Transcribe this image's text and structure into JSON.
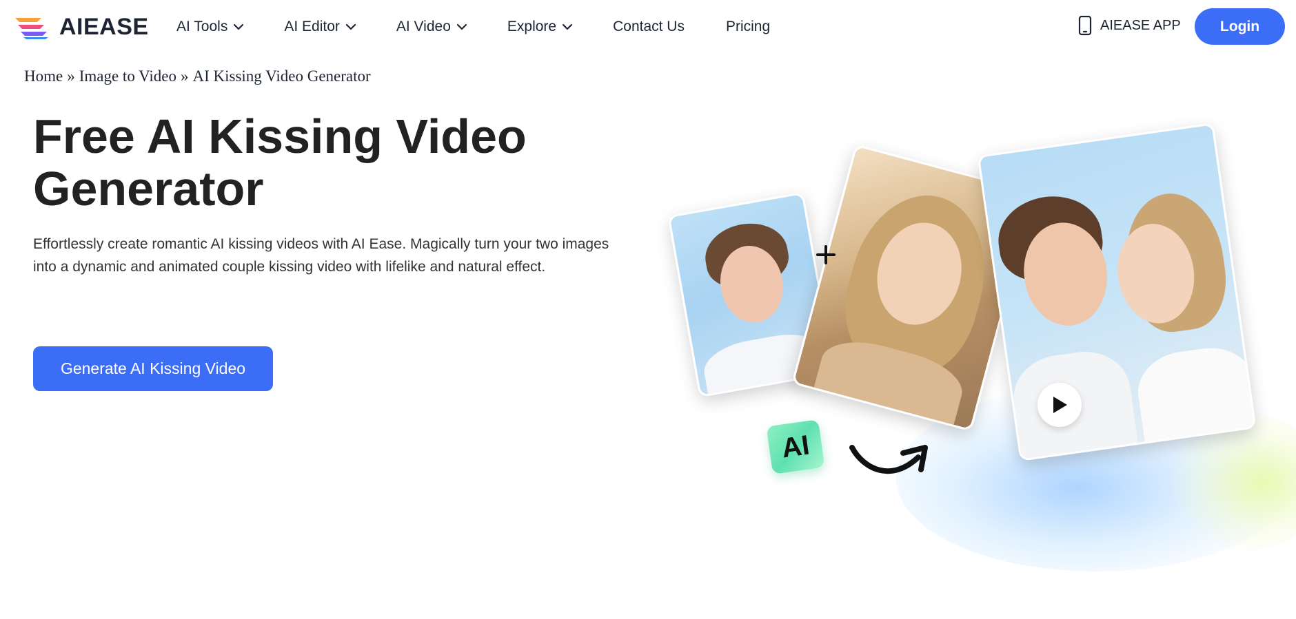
{
  "header": {
    "brand": "AIEASE",
    "nav": [
      {
        "label": "AI Tools",
        "dropdown": true
      },
      {
        "label": "AI Editor",
        "dropdown": true
      },
      {
        "label": "AI Video",
        "dropdown": true
      },
      {
        "label": "Explore",
        "dropdown": true
      },
      {
        "label": "Contact Us",
        "dropdown": false
      },
      {
        "label": "Pricing",
        "dropdown": false
      }
    ],
    "app_label": "AIEASE APP",
    "login_label": "Login"
  },
  "breadcrumb": {
    "items": [
      "Home",
      "Image to Video",
      "AI Kissing Video Generator"
    ],
    "separator": "»"
  },
  "hero": {
    "title": "Free AI Kissing Video Generator",
    "description": "Effortlessly create romantic AI kissing videos with AI Ease. Magically turn your two images into a dynamic and animated couple kissing video with lifelike and natural effect.",
    "cta_label": "Generate AI Kissing Video"
  },
  "illustration": {
    "badge_text": "AI",
    "icons": [
      "plus-icon",
      "play-icon",
      "curved-arrow-icon"
    ]
  },
  "colors": {
    "accent": "#3b6df6",
    "text": "#1d2433"
  }
}
